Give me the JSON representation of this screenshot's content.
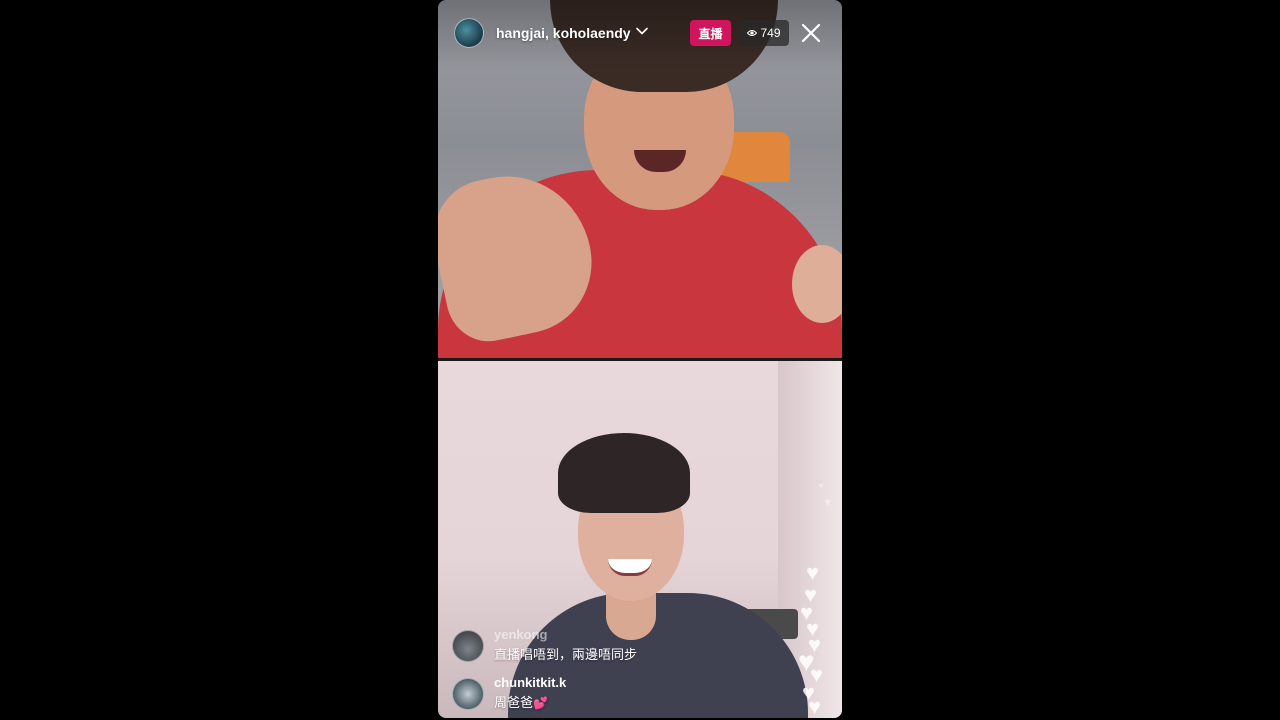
{
  "header": {
    "usernames": "hangjai, koholaendy",
    "live_label": "直播",
    "viewer_count": "749"
  },
  "comments": [
    {
      "user": "yenkong",
      "text": "直播唱唔到，兩邊唔同步"
    },
    {
      "user": "chunkitkit.k",
      "text": "周爸爸",
      "emoji": "💕"
    }
  ],
  "icons": {
    "chevron": "chevron-down-icon",
    "eye": "eye-icon",
    "close": "close-icon",
    "hearts": "heart-icon"
  },
  "colors": {
    "live_badge": "#d1155d",
    "background": "#000000"
  }
}
